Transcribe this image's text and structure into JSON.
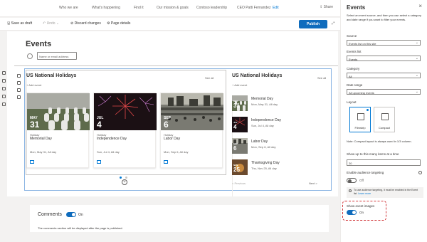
{
  "topnav": {
    "items": [
      "Who we are",
      "What's happening",
      "Find it",
      "Our mission & goals",
      "Contoso leadership",
      "CEO Patti Fernandez",
      "Edit"
    ],
    "share_label": "Share"
  },
  "toolbar": {
    "save_draft": "Save as draft",
    "undo": "Undo",
    "discard": "Discard changes",
    "page_details": "Page details",
    "publish": "Publish"
  },
  "page": {
    "title": "Events",
    "name_placeholder": "Name or email address"
  },
  "filmstrip": {
    "title": "US National Holidays",
    "see_all": "See all",
    "add_event": "+ Add event",
    "cards": [
      {
        "month": "MAY",
        "day": "31",
        "category": "Holiday",
        "title": "Memorial Day",
        "when": "Mon, May 31, All day"
      },
      {
        "month": "JUL",
        "day": "4",
        "category": "Holiday",
        "title": "Independence Day",
        "when": "Sun, Jul 4, All day"
      },
      {
        "month": "SEP",
        "day": "6",
        "category": "Holiday",
        "title": "Labor Day",
        "when": "Mon, Sep 6, All day"
      }
    ],
    "add_circle": "+"
  },
  "compact": {
    "title": "US National Holidays",
    "see_all": "See all",
    "add_event": "+ Add event",
    "rows": [
      {
        "month": "MAY",
        "day": "31",
        "title": "Memorial Day",
        "when": "Mon, May 31, All day"
      },
      {
        "month": "JUL",
        "day": "4",
        "title": "Independence Day",
        "when": "Sun, Jul 4, All day"
      },
      {
        "month": "SEP",
        "day": "6",
        "title": "Labor Day",
        "when": "Mon, Sep 6, All day"
      },
      {
        "month": "NOV",
        "day": "25",
        "title": "Thanksgiving Day",
        "when": "Thu, Nov 25, All day"
      }
    ],
    "previous": "< Previous",
    "next": "Next >"
  },
  "comments": {
    "title": "Comments",
    "toggle_label": "On",
    "toggle_on": true,
    "note": "The comments section will be displayed after the page is published."
  },
  "panel": {
    "title": "Events",
    "close": "×",
    "intro": "Select an event source, and then you can select a category and date range if you want to filter your events.",
    "source_label": "Source",
    "source_value": "Events list on this site",
    "events_list_label": "Events list",
    "events_list_value": "Events",
    "category_label": "Category",
    "category_value": "All",
    "date_range_label": "Date range",
    "date_range_value": "All upcoming events",
    "layout_label": "Layout",
    "layout_options": [
      "Filmstrip",
      "Compact"
    ],
    "layout_selected": "Filmstrip",
    "note": "Note: Compact layout is always used in 1/3 column.",
    "show_up_to_label": "Show up to this many items at a time",
    "show_up_to_value": "20",
    "audience_label": "Enable audience targeting",
    "audience_toggle_label": "Off",
    "audience_on": false,
    "warn_text": "To use audience targeting, it must be enabled in the Event list.",
    "warn_link": "Learn more",
    "show_images_label": "Show event images",
    "show_images_toggle_label": "On",
    "show_images_on": true
  },
  "colors": {
    "accent": "#0f6cbd",
    "highlight": "#d13438"
  }
}
